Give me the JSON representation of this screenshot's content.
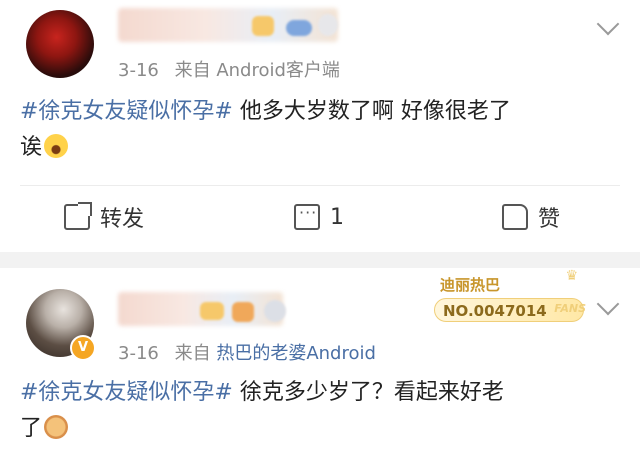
{
  "post1": {
    "time": "3-16",
    "source_prefix": "来自",
    "source": "Android客户端",
    "hashtag": "#徐克女友疑似怀孕#",
    "text_line1": " 他多大岁数了啊 好像很老了",
    "text_line2": "诶",
    "actions": {
      "share_label": "转发",
      "comment_count": "1",
      "like_label": "赞"
    }
  },
  "post2": {
    "time": "3-16",
    "source_prefix": "来自",
    "source": "热巴的老婆Android",
    "hashtag": "#徐克女友疑似怀孕#",
    "text_line1": " 徐克多少岁了？看起来好老",
    "text_line2": "了",
    "fans_badge": {
      "name": "迪丽热巴",
      "number": "NO.0047014",
      "tag": "FANS"
    },
    "avatar_badge": "V"
  },
  "icons": {
    "share": "share-icon",
    "comment": "comment-icon",
    "like": "thumbs-up-icon",
    "more": "chevron-down-icon"
  },
  "colors": {
    "link": "#4a6fa5",
    "meta": "#8a8a8a",
    "separator": "#f2f2f2",
    "fans_gold": "#c8962c"
  }
}
